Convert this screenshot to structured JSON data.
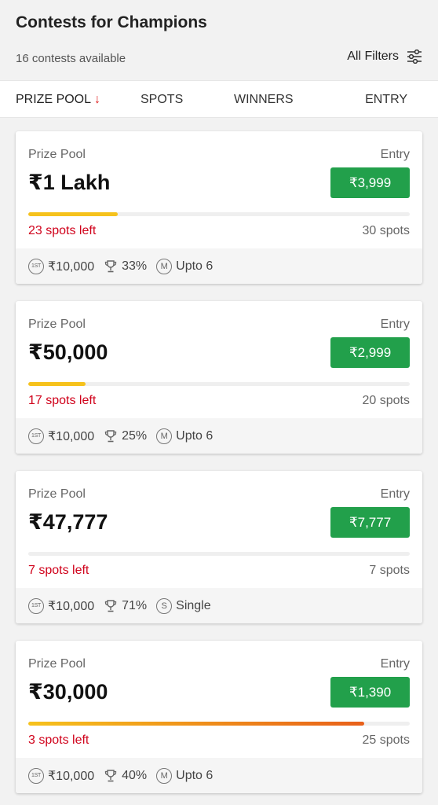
{
  "header": {
    "title": "Contests for Champions",
    "count": "16 contests available",
    "filters_label": "All Filters"
  },
  "sort": {
    "prize_pool": "PRIZE POOL",
    "prize_pool_arrow": "↓",
    "spots": "SPOTS",
    "winners": "WINNERS",
    "entry": "ENTRY"
  },
  "labels": {
    "prize_pool": "Prize Pool",
    "entry": "Entry",
    "first_badge": "1ST",
    "multi_badge": "M",
    "single_badge": "S"
  },
  "contests": [
    {
      "prize": "₹1 Lakh",
      "entry": "₹3,999",
      "fill_fraction": 0.234,
      "hot": false,
      "spots_left": "23 spots left",
      "spots_total": "30 spots",
      "first": "₹10,000",
      "winners": "33%",
      "entry_type_badge": "M",
      "entry_type": "Upto 6"
    },
    {
      "prize": "₹50,000",
      "entry": "₹2,999",
      "fill_fraction": 0.15,
      "hot": false,
      "spots_left": "17 spots left",
      "spots_total": "20 spots",
      "first": "₹10,000",
      "winners": "25%",
      "entry_type_badge": "M",
      "entry_type": "Upto 6"
    },
    {
      "prize": "₹47,777",
      "entry": "₹7,777",
      "fill_fraction": 0.0,
      "hot": false,
      "spots_left": "7 spots left",
      "spots_total": "7 spots",
      "first": "₹10,000",
      "winners": "71%",
      "entry_type_badge": "S",
      "entry_type": "Single"
    },
    {
      "prize": "₹30,000",
      "entry": "₹1,390",
      "fill_fraction": 0.88,
      "hot": true,
      "spots_left": "3 spots left",
      "spots_total": "25 spots",
      "first": "₹10,000",
      "winners": "40%",
      "entry_type_badge": "M",
      "entry_type": "Upto 6"
    }
  ],
  "colors": {
    "entry_green": "#22a04b",
    "spots_left_red": "#d0021b",
    "progress_yellow": "#f6c21c",
    "progress_orange": "#e8601a"
  }
}
